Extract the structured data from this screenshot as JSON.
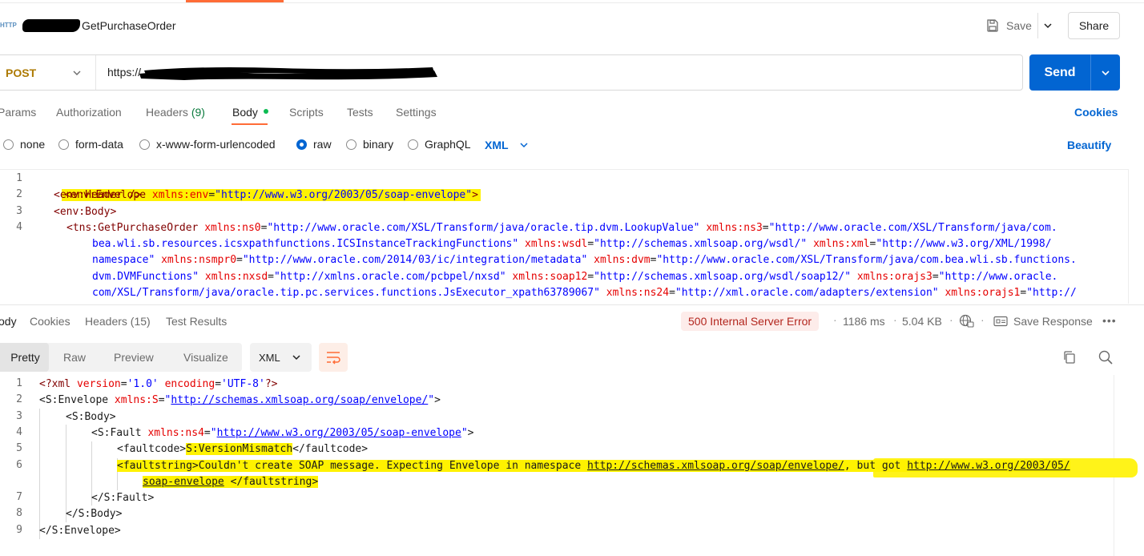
{
  "header": {
    "method_badge": "HTTP",
    "title": "GetPurchaseOrder",
    "save_label": "Save",
    "share_label": "Share"
  },
  "request": {
    "method": "POST",
    "url_prefix": "https://",
    "send_label": "Send"
  },
  "req_tabs": [
    {
      "label": "Params"
    },
    {
      "label": "Authorization"
    },
    {
      "label": "Headers",
      "count": "(9)"
    },
    {
      "label": "Body"
    },
    {
      "label": "Scripts"
    },
    {
      "label": "Tests"
    },
    {
      "label": "Settings"
    }
  ],
  "cookies_link": "Cookies",
  "body_types": [
    "none",
    "form-data",
    "x-www-form-urlencoded",
    "raw",
    "binary",
    "GraphQL"
  ],
  "body_selected": "raw",
  "body_format": "XML",
  "beautify_label": "Beautify",
  "request_body": {
    "line_numbers": [
      "1",
      "2",
      "3",
      "4"
    ],
    "l1": {
      "open": "<env:Envelope ",
      "attr": "xmlns:env",
      "eq": "=",
      "val": "\"http://www.w3.org/2003/05/soap-envelope\"",
      "close": ">"
    },
    "l2": "<env:Header />",
    "l3": "<env:Body>",
    "l4": [
      {
        "k": "tag",
        "t": "<tns:GetPurchaseOrder "
      },
      {
        "k": "attr",
        "t": "xmlns:ns0"
      },
      {
        "k": "t",
        "t": "="
      },
      {
        "k": "val",
        "t": "\"http://www.oracle.com/XSL/Transform/java/oracle.tip.dvm.LookupValue\""
      },
      {
        "k": "t",
        "t": " "
      },
      {
        "k": "attr",
        "t": "xmlns:ns3"
      },
      {
        "k": "t",
        "t": "="
      },
      {
        "k": "val",
        "t": "\"http://www.oracle.com/XSL/Transform/java/com."
      }
    ],
    "l4_wrap": [
      [
        {
          "k": "val",
          "t": "bea.wli.sb.resources.icsxpathfunctions.ICSInstanceTrackingFunctions\""
        },
        {
          "k": "t",
          "t": " "
        },
        {
          "k": "attr",
          "t": "xmlns:wsdl"
        },
        {
          "k": "t",
          "t": "="
        },
        {
          "k": "val",
          "t": "\"http://schemas.xmlsoap.org/wsdl/\""
        },
        {
          "k": "t",
          "t": " "
        },
        {
          "k": "attr",
          "t": "xmlns:xml"
        },
        {
          "k": "t",
          "t": "="
        },
        {
          "k": "val",
          "t": "\"http://www.w3.org/XML/1998/"
        }
      ],
      [
        {
          "k": "val",
          "t": "namespace\""
        },
        {
          "k": "t",
          "t": " "
        },
        {
          "k": "attr",
          "t": "xmlns:nsmpr0"
        },
        {
          "k": "t",
          "t": "="
        },
        {
          "k": "val",
          "t": "\"http://www.oracle.com/2014/03/ic/integration/metadata\""
        },
        {
          "k": "t",
          "t": " "
        },
        {
          "k": "attr",
          "t": "xmlns:dvm"
        },
        {
          "k": "t",
          "t": "="
        },
        {
          "k": "val",
          "t": "\"http://www.oracle.com/XSL/Transform/java/com.bea.wli.sb.functions."
        }
      ],
      [
        {
          "k": "val",
          "t": "dvm.DVMFunctions\""
        },
        {
          "k": "t",
          "t": " "
        },
        {
          "k": "attr",
          "t": "xmlns:nxsd"
        },
        {
          "k": "t",
          "t": "="
        },
        {
          "k": "val",
          "t": "\"http://xmlns.oracle.com/pcbpel/nxsd\""
        },
        {
          "k": "t",
          "t": " "
        },
        {
          "k": "attr",
          "t": "xmlns:soap12"
        },
        {
          "k": "t",
          "t": "="
        },
        {
          "k": "val",
          "t": "\"http://schemas.xmlsoap.org/wsdl/soap12/\""
        },
        {
          "k": "t",
          "t": " "
        },
        {
          "k": "attr",
          "t": "xmlns:orajs3"
        },
        {
          "k": "t",
          "t": "="
        },
        {
          "k": "val",
          "t": "\"http://www.oracle."
        }
      ],
      [
        {
          "k": "val",
          "t": "com/XSL/Transform/java/oracle.tip.pc.services.functions.JsExecutor_xpath63789067\""
        },
        {
          "k": "t",
          "t": " "
        },
        {
          "k": "attr",
          "t": "xmlns:ns24"
        },
        {
          "k": "t",
          "t": "="
        },
        {
          "k": "val",
          "t": "\"http://xml.oracle.com/adapters/extension\""
        },
        {
          "k": "t",
          "t": " "
        },
        {
          "k": "attr",
          "t": "xmlns:orajs1"
        },
        {
          "k": "t",
          "t": "="
        },
        {
          "k": "val",
          "t": "\"http://"
        }
      ]
    ]
  },
  "resp_tabs": [
    {
      "label": "ody"
    },
    {
      "label": "Cookies"
    },
    {
      "label": "Headers (15)"
    },
    {
      "label": "Test Results"
    }
  ],
  "status": {
    "code_text": "500 Internal Server Error",
    "time": "1186 ms",
    "size": "5.04 KB",
    "save_response": "Save Response",
    "status_bg": "#fdecea",
    "status_color": "#b3261e"
  },
  "view_tabs": [
    "Pretty",
    "Raw",
    "Preview",
    "Visualize"
  ],
  "view_format": "XML",
  "response_body": {
    "line_numbers": [
      "1",
      "2",
      "3",
      "4",
      "5",
      "6",
      "",
      "7",
      "8",
      "9"
    ],
    "lines": [
      [
        {
          "k": "pi",
          "t": "<?xml "
        },
        {
          "k": "attr",
          "t": "version"
        },
        {
          "k": "t",
          "t": "="
        },
        {
          "k": "val",
          "t": "'1.0'"
        },
        {
          "k": "t",
          "t": " "
        },
        {
          "k": "attr",
          "t": "encoding"
        },
        {
          "k": "t",
          "t": "="
        },
        {
          "k": "val",
          "t": "'UTF-8'"
        },
        {
          "k": "pi",
          "t": "?>"
        }
      ],
      [
        {
          "k": "tagb",
          "t": "<S:Envelope "
        },
        {
          "k": "attr",
          "t": "xmlns:S"
        },
        {
          "k": "t",
          "t": "="
        },
        {
          "k": "val",
          "t": "\""
        },
        {
          "k": "url",
          "t": "http://schemas.xmlsoap.org/soap/envelope/"
        },
        {
          "k": "val",
          "t": "\""
        },
        {
          "k": "tagb",
          "t": ">"
        }
      ],
      [
        {
          "k": "tagb",
          "t": "<S:Body>"
        }
      ],
      [
        {
          "k": "tagb",
          "t": "<S:Fault "
        },
        {
          "k": "attr",
          "t": "xmlns:ns4"
        },
        {
          "k": "t",
          "t": "="
        },
        {
          "k": "val",
          "t": "\""
        },
        {
          "k": "url",
          "t": "http://www.w3.org/2003/05/soap-envelope"
        },
        {
          "k": "val",
          "t": "\""
        },
        {
          "k": "tagb",
          "t": ">"
        }
      ],
      [
        {
          "k": "tagb",
          "t": "<faultcode>"
        },
        {
          "k": "hl",
          "t": "S:VersionMismatch"
        },
        {
          "k": "tagb",
          "t": "</faultcode>"
        }
      ],
      [
        {
          "k": "hl",
          "t": "<faultstring>Couldn't create SOAP message. Expecting Envelope in namespace "
        },
        {
          "k": "hlul",
          "t": "http://schemas.xmlsoap.org/soap/envelope/"
        },
        {
          "k": "hl",
          "t": ", but got "
        },
        {
          "k": "hlul",
          "t": "http://www.w3.org/2003/05/"
        }
      ],
      [
        {
          "k": "hlul",
          "t": "soap-envelope"
        },
        {
          "k": "hl",
          "t": " </faultstring>"
        }
      ],
      [
        {
          "k": "tagb",
          "t": "</S:Fault>"
        }
      ],
      [
        {
          "k": "tagb",
          "t": "</S:Body>"
        }
      ],
      [
        {
          "k": "tagb",
          "t": "</S:Envelope>"
        }
      ]
    ]
  },
  "colors": {
    "accent_orange": "#ff6c37",
    "send_blue": "#0265d2",
    "link_blue": "#0265d2",
    "highlight_yellow": "#fff200",
    "method_post": "#ad7a03"
  }
}
